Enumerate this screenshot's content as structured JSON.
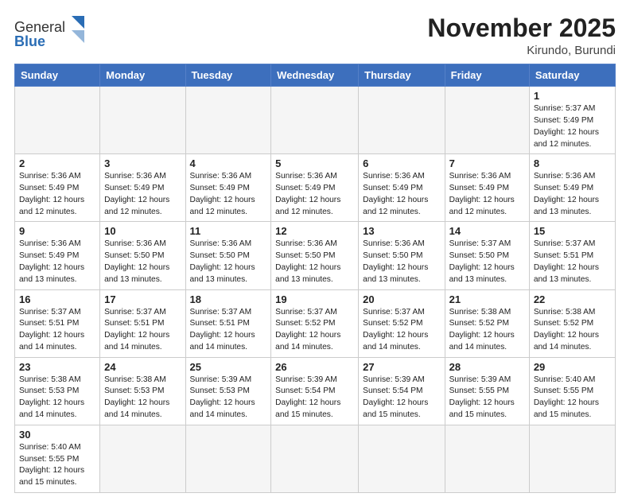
{
  "header": {
    "logo_general": "General",
    "logo_blue": "Blue",
    "month_title": "November 2025",
    "location": "Kirundo, Burundi"
  },
  "days_of_week": [
    "Sunday",
    "Monday",
    "Tuesday",
    "Wednesday",
    "Thursday",
    "Friday",
    "Saturday"
  ],
  "weeks": [
    [
      {
        "day": "",
        "info": ""
      },
      {
        "day": "",
        "info": ""
      },
      {
        "day": "",
        "info": ""
      },
      {
        "day": "",
        "info": ""
      },
      {
        "day": "",
        "info": ""
      },
      {
        "day": "",
        "info": ""
      },
      {
        "day": "1",
        "info": "Sunrise: 5:37 AM\nSunset: 5:49 PM\nDaylight: 12 hours\nand 12 minutes."
      }
    ],
    [
      {
        "day": "2",
        "info": "Sunrise: 5:36 AM\nSunset: 5:49 PM\nDaylight: 12 hours\nand 12 minutes."
      },
      {
        "day": "3",
        "info": "Sunrise: 5:36 AM\nSunset: 5:49 PM\nDaylight: 12 hours\nand 12 minutes."
      },
      {
        "day": "4",
        "info": "Sunrise: 5:36 AM\nSunset: 5:49 PM\nDaylight: 12 hours\nand 12 minutes."
      },
      {
        "day": "5",
        "info": "Sunrise: 5:36 AM\nSunset: 5:49 PM\nDaylight: 12 hours\nand 12 minutes."
      },
      {
        "day": "6",
        "info": "Sunrise: 5:36 AM\nSunset: 5:49 PM\nDaylight: 12 hours\nand 12 minutes."
      },
      {
        "day": "7",
        "info": "Sunrise: 5:36 AM\nSunset: 5:49 PM\nDaylight: 12 hours\nand 12 minutes."
      },
      {
        "day": "8",
        "info": "Sunrise: 5:36 AM\nSunset: 5:49 PM\nDaylight: 12 hours\nand 13 minutes."
      }
    ],
    [
      {
        "day": "9",
        "info": "Sunrise: 5:36 AM\nSunset: 5:49 PM\nDaylight: 12 hours\nand 13 minutes."
      },
      {
        "day": "10",
        "info": "Sunrise: 5:36 AM\nSunset: 5:50 PM\nDaylight: 12 hours\nand 13 minutes."
      },
      {
        "day": "11",
        "info": "Sunrise: 5:36 AM\nSunset: 5:50 PM\nDaylight: 12 hours\nand 13 minutes."
      },
      {
        "day": "12",
        "info": "Sunrise: 5:36 AM\nSunset: 5:50 PM\nDaylight: 12 hours\nand 13 minutes."
      },
      {
        "day": "13",
        "info": "Sunrise: 5:36 AM\nSunset: 5:50 PM\nDaylight: 12 hours\nand 13 minutes."
      },
      {
        "day": "14",
        "info": "Sunrise: 5:37 AM\nSunset: 5:50 PM\nDaylight: 12 hours\nand 13 minutes."
      },
      {
        "day": "15",
        "info": "Sunrise: 5:37 AM\nSunset: 5:51 PM\nDaylight: 12 hours\nand 13 minutes."
      }
    ],
    [
      {
        "day": "16",
        "info": "Sunrise: 5:37 AM\nSunset: 5:51 PM\nDaylight: 12 hours\nand 14 minutes."
      },
      {
        "day": "17",
        "info": "Sunrise: 5:37 AM\nSunset: 5:51 PM\nDaylight: 12 hours\nand 14 minutes."
      },
      {
        "day": "18",
        "info": "Sunrise: 5:37 AM\nSunset: 5:51 PM\nDaylight: 12 hours\nand 14 minutes."
      },
      {
        "day": "19",
        "info": "Sunrise: 5:37 AM\nSunset: 5:52 PM\nDaylight: 12 hours\nand 14 minutes."
      },
      {
        "day": "20",
        "info": "Sunrise: 5:37 AM\nSunset: 5:52 PM\nDaylight: 12 hours\nand 14 minutes."
      },
      {
        "day": "21",
        "info": "Sunrise: 5:38 AM\nSunset: 5:52 PM\nDaylight: 12 hours\nand 14 minutes."
      },
      {
        "day": "22",
        "info": "Sunrise: 5:38 AM\nSunset: 5:52 PM\nDaylight: 12 hours\nand 14 minutes."
      }
    ],
    [
      {
        "day": "23",
        "info": "Sunrise: 5:38 AM\nSunset: 5:53 PM\nDaylight: 12 hours\nand 14 minutes."
      },
      {
        "day": "24",
        "info": "Sunrise: 5:38 AM\nSunset: 5:53 PM\nDaylight: 12 hours\nand 14 minutes."
      },
      {
        "day": "25",
        "info": "Sunrise: 5:39 AM\nSunset: 5:53 PM\nDaylight: 12 hours\nand 14 minutes."
      },
      {
        "day": "26",
        "info": "Sunrise: 5:39 AM\nSunset: 5:54 PM\nDaylight: 12 hours\nand 15 minutes."
      },
      {
        "day": "27",
        "info": "Sunrise: 5:39 AM\nSunset: 5:54 PM\nDaylight: 12 hours\nand 15 minutes."
      },
      {
        "day": "28",
        "info": "Sunrise: 5:39 AM\nSunset: 5:55 PM\nDaylight: 12 hours\nand 15 minutes."
      },
      {
        "day": "29",
        "info": "Sunrise: 5:40 AM\nSunset: 5:55 PM\nDaylight: 12 hours\nand 15 minutes."
      }
    ],
    [
      {
        "day": "30",
        "info": "Sunrise: 5:40 AM\nSunset: 5:55 PM\nDaylight: 12 hours\nand 15 minutes."
      },
      {
        "day": "",
        "info": ""
      },
      {
        "day": "",
        "info": ""
      },
      {
        "day": "",
        "info": ""
      },
      {
        "day": "",
        "info": ""
      },
      {
        "day": "",
        "info": ""
      },
      {
        "day": "",
        "info": ""
      }
    ]
  ]
}
